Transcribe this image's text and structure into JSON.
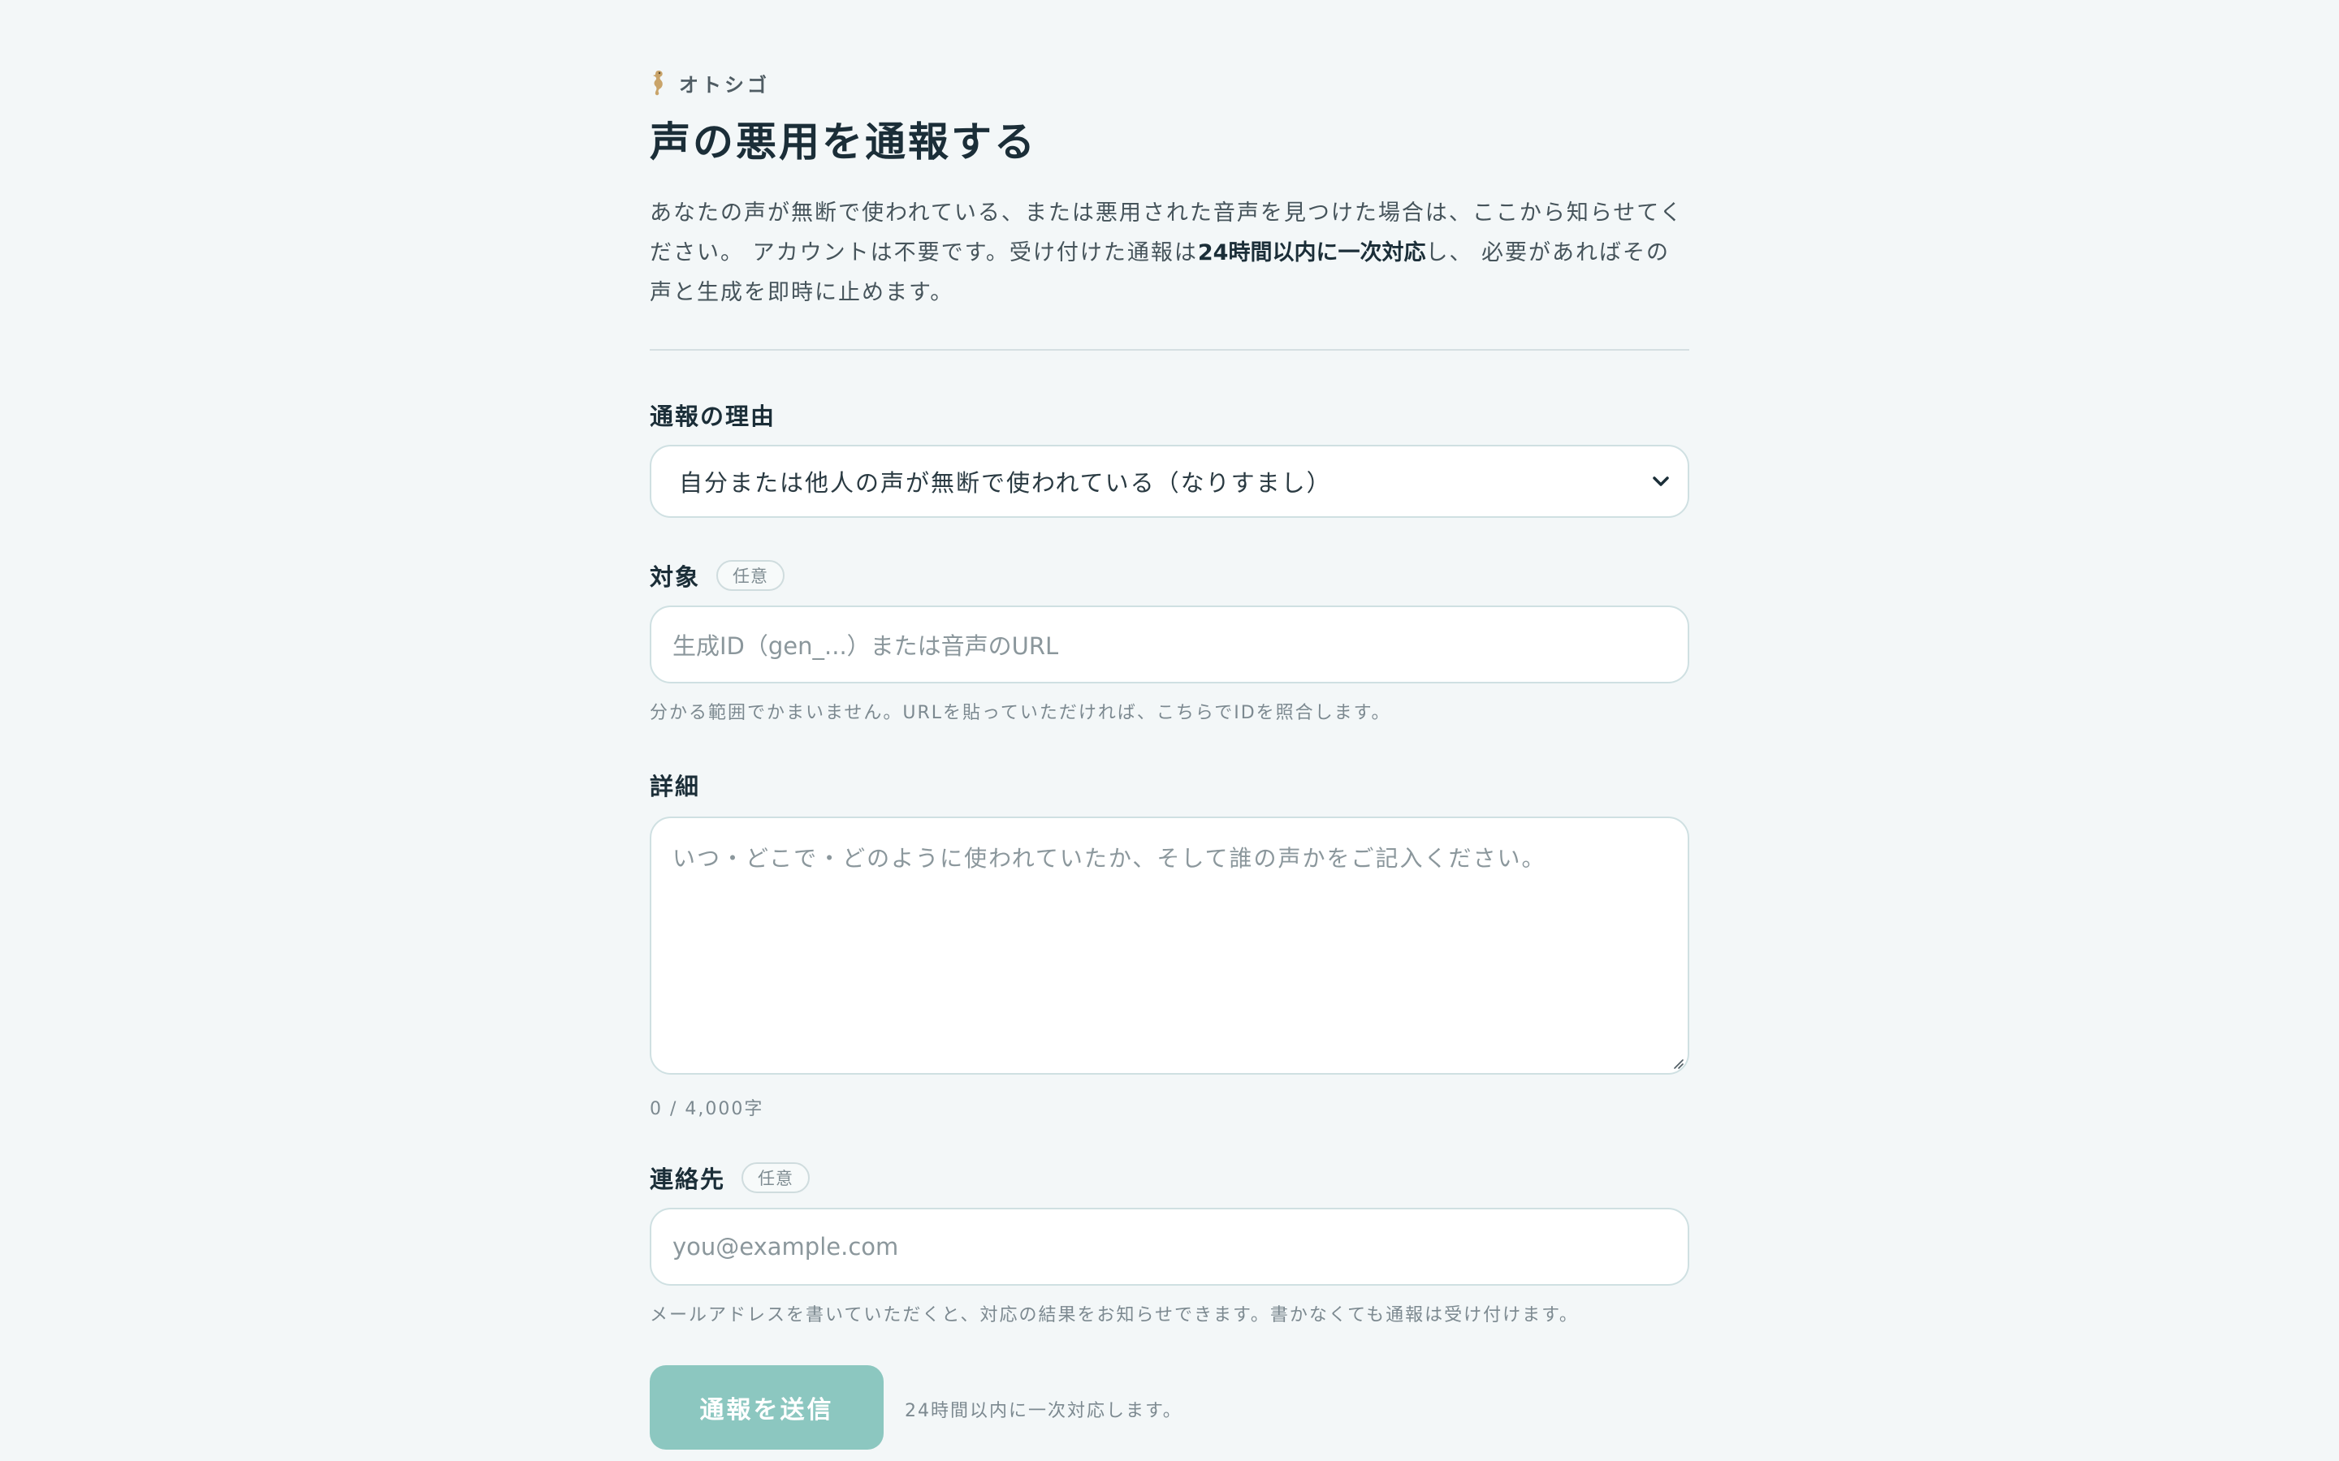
{
  "brand": {
    "name": "オトシゴ",
    "icon": "seahorse-icon"
  },
  "page": {
    "title": "声の悪用を通報する",
    "intro_part1": "あなたの声が無断で使われている、または悪用された音声を見つけた場合は、ここから知らせてください。 アカウントは不要です。受け付けた通報は",
    "intro_strong": "24時間以内に一次対応",
    "intro_part2": "し、 必要があればその声と生成を即時に止めます。"
  },
  "form": {
    "reason": {
      "label": "通報の理由",
      "selected": "自分または他人の声が無断で使われている（なりすまし）",
      "icon": "chevron-down-icon"
    },
    "target": {
      "label": "対象",
      "badge": "任意",
      "placeholder": "生成ID（gen_...）または音声のURL",
      "hint": "分かる範囲でかまいません。URLを貼っていただければ、こちらでIDを照合します。"
    },
    "details": {
      "label": "詳細",
      "placeholder": "いつ・どこで・どのように使われていたか、そして誰の声かをご記入ください。",
      "counter": "0 / 4,000字"
    },
    "contact": {
      "label": "連絡先",
      "badge": "任意",
      "placeholder": "you@example.com",
      "hint": "メールアドレスを書いていただくと、対応の結果をお知らせできます。書かなくても通報は受け付けます。"
    },
    "submit": {
      "label": "通報を送信",
      "note": "24時間以内に一次対応します。"
    }
  },
  "colors": {
    "background": "#f3f7f8",
    "accent": "#8cc7c0",
    "heading": "#1b2e38",
    "border": "#cfe0e2"
  }
}
